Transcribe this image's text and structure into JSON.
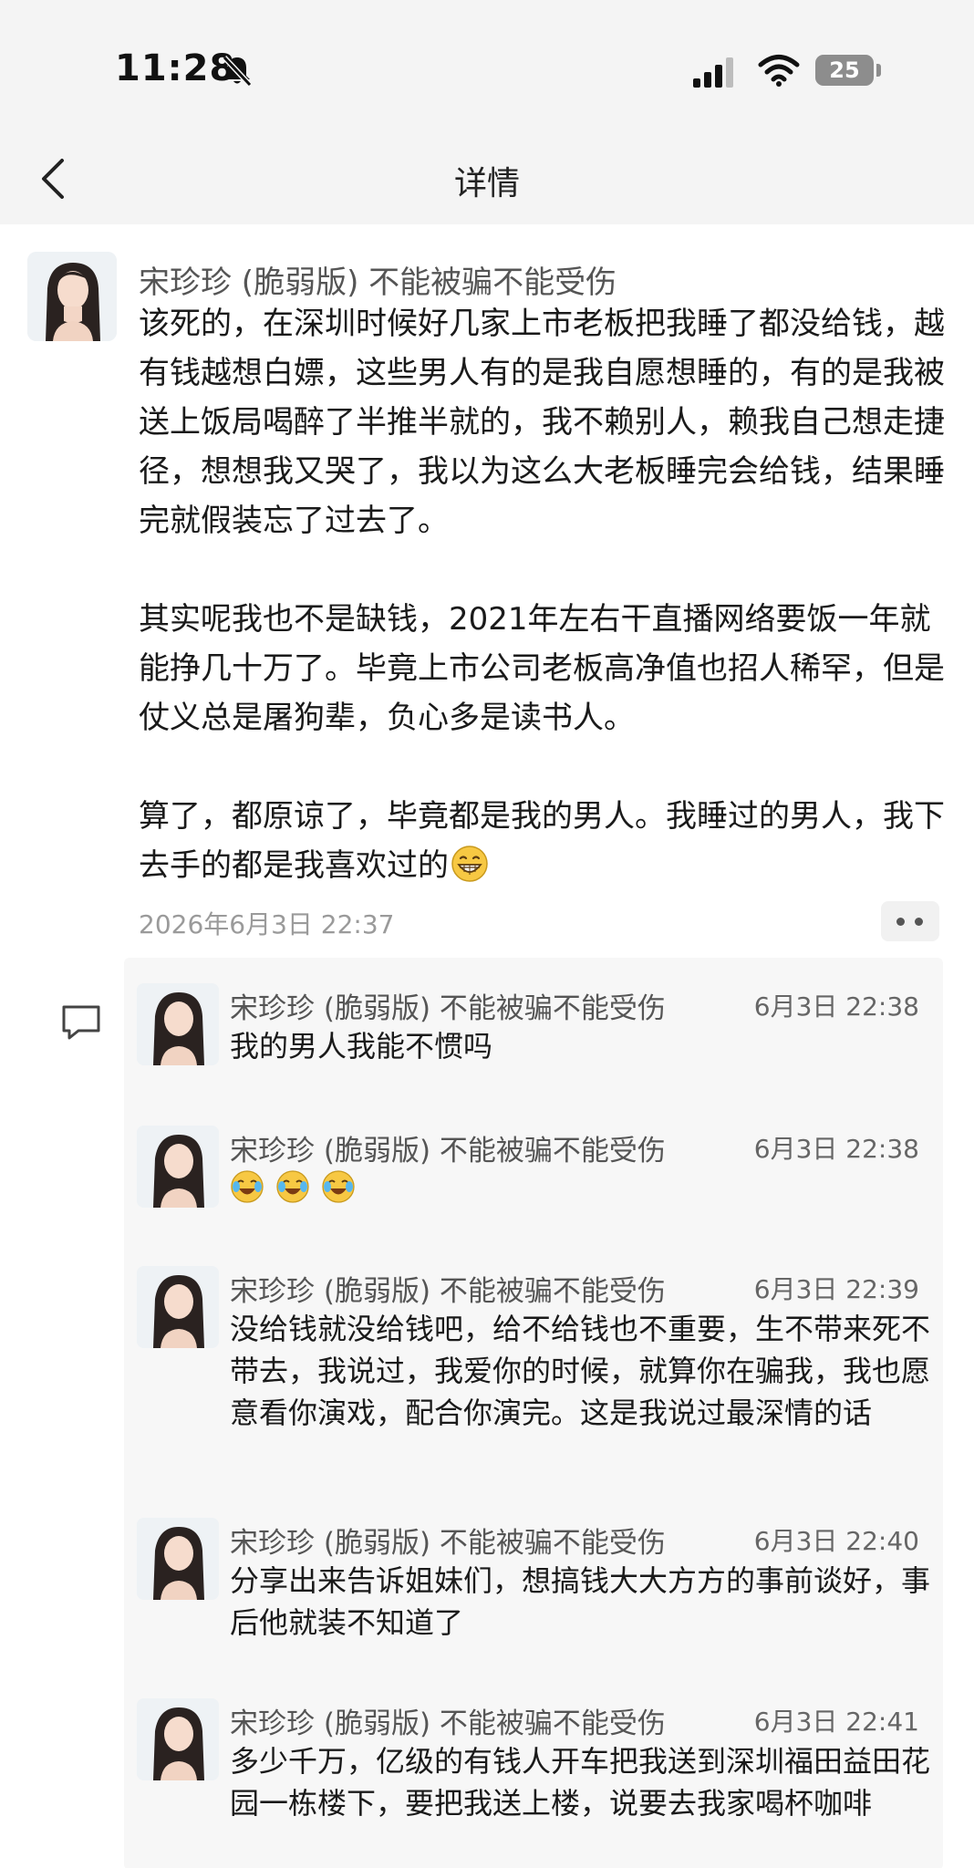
{
  "status_bar": {
    "time": "11:28",
    "battery": "25"
  },
  "nav": {
    "title": "详情"
  },
  "post": {
    "author": "宋珍珍 (脆弱版) 不能被骗不能受伤",
    "paragraphs": [
      "该死的，在深圳时候好几家上市老板把我睡了都没给钱，越有钱越想白嫖，这些男人有的是我自愿想睡的，有的是我被送上饭局喝醉了半推半就的，我不赖别人，赖我自己想走捷径，想想我又哭了，我以为这么大老板睡完会给钱，结果睡完就假装忘了过去了。",
      "其实呢我也不是缺钱，2021年左右干直播网络要饭一年就能挣几十万了。毕竟上市公司老板高净值也招人稀罕，但是仗义总是屠狗辈，负心多是读书人。",
      "算了，都原谅了，毕竟都是我的男人。我睡过的男人，我下去手的都是我喜欢过的"
    ],
    "time": "2026年6月3日 22:37"
  },
  "comments": [
    {
      "author": "宋珍珍 (脆弱版) 不能被骗不能受伤",
      "time": "6月3日 22:38",
      "text": "我的男人我能不惯吗"
    },
    {
      "author": "宋珍珍 (脆弱版) 不能被骗不能受伤",
      "time": "6月3日 22:38",
      "text": ""
    },
    {
      "author": "宋珍珍 (脆弱版) 不能被骗不能受伤",
      "time": "6月3日 22:39",
      "text": "没给钱就没给钱吧，给不给钱也不重要，生不带来死不带去，我说过，我爱你的时候，就算你在骗我，我也愿意看你演戏，配合你演完。这是我说过最深情的话"
    },
    {
      "author": "宋珍珍 (脆弱版) 不能被骗不能受伤",
      "time": "6月3日 22:40",
      "text": "分享出来告诉姐妹们，想搞钱大大方方的事前谈好，事后他就装不知道了"
    },
    {
      "author": "宋珍珍 (脆弱版) 不能被骗不能受伤",
      "time": "6月3日 22:41",
      "text": "多少千万，亿级的有钱人开车把我送到深圳福田益田花园一栋楼下，要把我送上楼，说要去我家喝杯咖啡"
    }
  ],
  "icons": {
    "mute": "bell-slash-icon",
    "signal": "cellular-signal-icon",
    "wifi": "wifi-icon",
    "back": "chevron-left-icon",
    "more": "ellipsis-icon",
    "comment": "comment-bubble-icon",
    "grin_emoji": "grinning-emoji",
    "cry_emoji": "crying-laughing-emoji"
  }
}
